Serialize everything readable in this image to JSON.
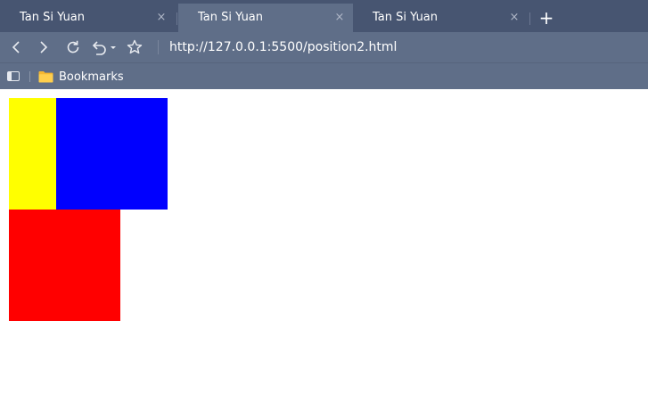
{
  "tabs": [
    {
      "title": "Tan Si Yuan",
      "active": false
    },
    {
      "title": "Tan Si Yuan",
      "active": true
    },
    {
      "title": "Tan Si Yuan",
      "active": false
    }
  ],
  "tab_close_glyph": "×",
  "new_tab_glyph": "+",
  "address_bar": {
    "url": "http://127.0.0.1:5500/position2.html"
  },
  "bookmarks_bar": {
    "folder_label": "Bookmarks"
  },
  "icons": {
    "back": "chevron-left-icon",
    "forward": "chevron-right-icon",
    "reload": "reload-icon",
    "undo": "undo-icon",
    "bookmark": "star-icon",
    "sidebar": "sidebar-toggle-icon",
    "folder": "folder-icon"
  },
  "page": {
    "boxes": [
      {
        "name": "yellow",
        "color": "#ffff00"
      },
      {
        "name": "blue",
        "color": "#0000ff"
      },
      {
        "name": "red",
        "color": "#ff0000"
      }
    ]
  }
}
